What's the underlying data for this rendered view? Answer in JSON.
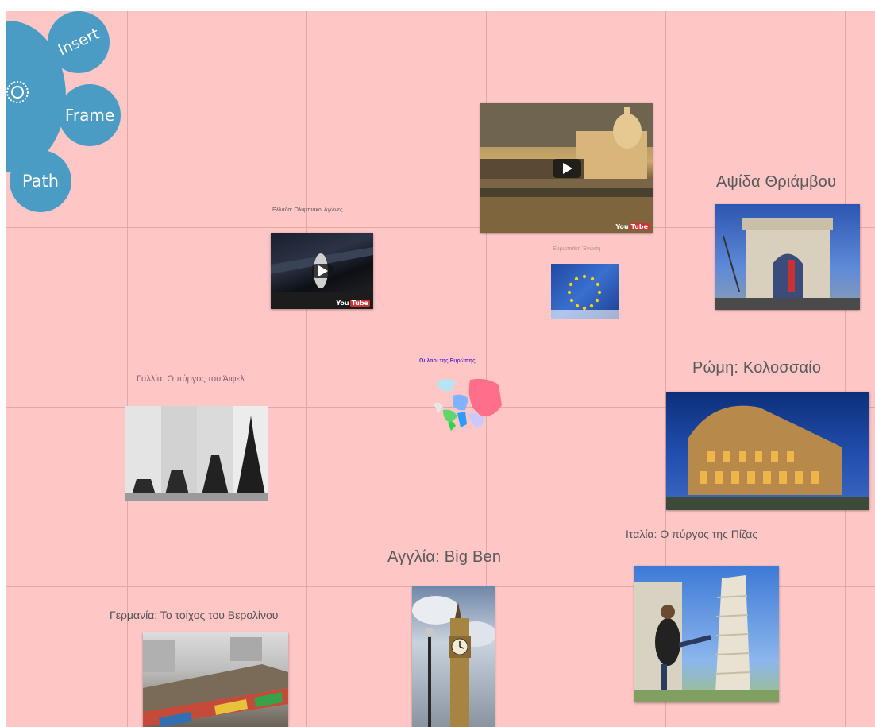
{
  "menu": {
    "insert_label": "Insert",
    "frame_label": "Frame",
    "path_label": "Path"
  },
  "colors": {
    "canvas_bg": "#ffc6c6",
    "grid": "#e0a9a9",
    "menu_blue": "#4a9cc4"
  },
  "center": {
    "title": "Οι λαοί της Ευρώπης"
  },
  "captions": {
    "greece": "Ελλάδα: Ολυμπιακοί Αγώνες",
    "eu": "Ευρωπαϊκή Ένωση",
    "arc": "Αψίδα Θριάμβου",
    "france": "Γαλλία: Ο πύργος του Άιφελ",
    "rome": "Ρώμη: Κολοσσαίο",
    "italy": "Ιταλία: Ο πύργος της Πίζας",
    "england": "Αγγλία: Big Ben",
    "germany": "Γερμανία: Το τοίχος του Βερολίνου"
  },
  "videos": {
    "youtube_label": "You",
    "youtube_tube": "Tube"
  }
}
